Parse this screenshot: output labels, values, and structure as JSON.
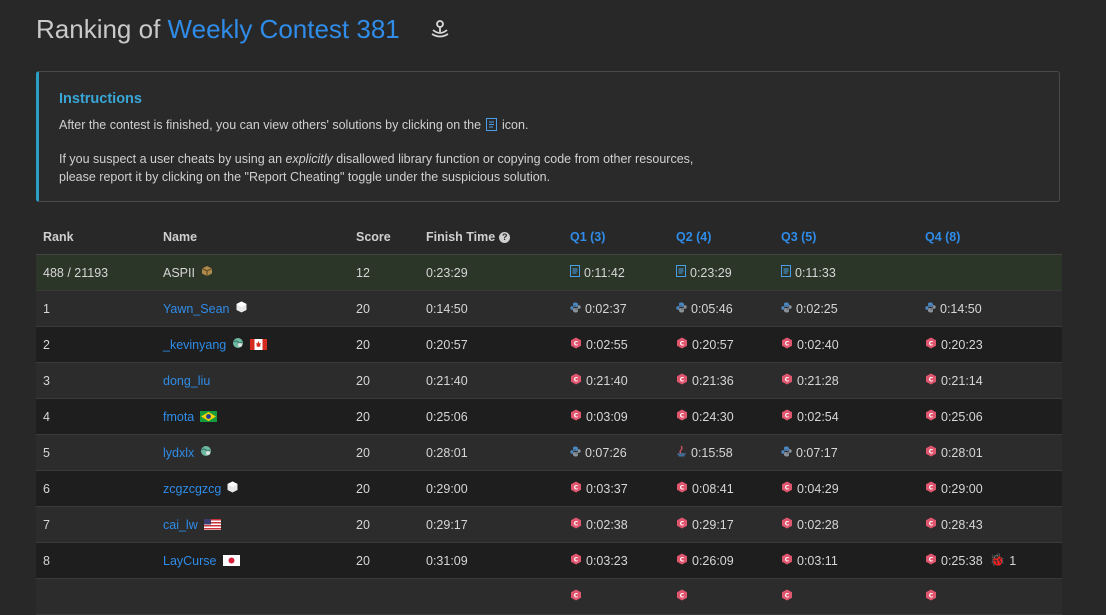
{
  "page": {
    "title_prefix": "Ranking of",
    "contest_name": "Weekly Contest 381"
  },
  "instructions": {
    "heading": "Instructions",
    "line1_before": "After the contest is finished, you can view others' solutions by clicking on the",
    "line1_after": "icon.",
    "line2_before": "If you suspect a user cheats by using an",
    "line2_emph": "explicitly",
    "line2_after": "disallowed library function or copying code from other resources,",
    "line3": "please report it by clicking on the \"Report Cheating\" toggle under the suspicious solution."
  },
  "table": {
    "headers": {
      "rank": "Rank",
      "name": "Name",
      "score": "Score",
      "finish_time": "Finish Time",
      "q1": "Q1 (3)",
      "q2": "Q2 (4)",
      "q3": "Q3 (5)",
      "q4": "Q4 (8)"
    },
    "my_row": {
      "rank": "488 / 21193",
      "name": "ASPII",
      "score": "12",
      "finish_time": "0:23:29",
      "q1": "0:11:42",
      "q2": "0:23:29",
      "q3": "0:11:33",
      "q4": ""
    },
    "rows": [
      {
        "rank": "1",
        "name": "Yawn_Sean",
        "badge": "white-hex-badge",
        "flag": "",
        "score": "20",
        "finish_time": "0:14:50",
        "q": [
          {
            "lang": "python",
            "time": "0:02:37"
          },
          {
            "lang": "python",
            "time": "0:05:46"
          },
          {
            "lang": "python",
            "time": "0:02:25"
          },
          {
            "lang": "python",
            "time": "0:14:50"
          }
        ]
      },
      {
        "rank": "2",
        "name": "_kevinyang",
        "badge": "globe-badge",
        "flag": "canada",
        "score": "20",
        "finish_time": "0:20:57",
        "q": [
          {
            "lang": "cpp",
            "time": "0:02:55"
          },
          {
            "lang": "cpp",
            "time": "0:20:57"
          },
          {
            "lang": "cpp",
            "time": "0:02:40"
          },
          {
            "lang": "cpp",
            "time": "0:20:23"
          }
        ]
      },
      {
        "rank": "3",
        "name": "dong_liu",
        "badge": "",
        "flag": "",
        "score": "20",
        "finish_time": "0:21:40",
        "q": [
          {
            "lang": "cpp",
            "time": "0:21:40"
          },
          {
            "lang": "cpp",
            "time": "0:21:36"
          },
          {
            "lang": "cpp",
            "time": "0:21:28"
          },
          {
            "lang": "cpp",
            "time": "0:21:14"
          }
        ]
      },
      {
        "rank": "4",
        "name": "fmota",
        "badge": "",
        "flag": "brazil",
        "score": "20",
        "finish_time": "0:25:06",
        "q": [
          {
            "lang": "cpp",
            "time": "0:03:09"
          },
          {
            "lang": "cpp",
            "time": "0:24:30"
          },
          {
            "lang": "cpp",
            "time": "0:02:54"
          },
          {
            "lang": "cpp",
            "time": "0:25:06"
          }
        ]
      },
      {
        "rank": "5",
        "name": "lydxlx",
        "badge": "globe-badge",
        "flag": "",
        "score": "20",
        "finish_time": "0:28:01",
        "q": [
          {
            "lang": "python",
            "time": "0:07:26"
          },
          {
            "lang": "java",
            "time": "0:15:58"
          },
          {
            "lang": "python",
            "time": "0:07:17"
          },
          {
            "lang": "cpp",
            "time": "0:28:01"
          }
        ]
      },
      {
        "rank": "6",
        "name": "zcgzcgzcg",
        "badge": "white-hex-badge",
        "flag": "",
        "score": "20",
        "finish_time": "0:29:00",
        "q": [
          {
            "lang": "cpp",
            "time": "0:03:37"
          },
          {
            "lang": "cpp",
            "time": "0:08:41"
          },
          {
            "lang": "cpp",
            "time": "0:04:29"
          },
          {
            "lang": "cpp",
            "time": "0:29:00"
          }
        ]
      },
      {
        "rank": "7",
        "name": "cai_lw",
        "badge": "",
        "flag": "usa",
        "score": "20",
        "finish_time": "0:29:17",
        "q": [
          {
            "lang": "cpp",
            "time": "0:02:38"
          },
          {
            "lang": "cpp",
            "time": "0:29:17"
          },
          {
            "lang": "cpp",
            "time": "0:02:28"
          },
          {
            "lang": "cpp",
            "time": "0:28:43"
          }
        ]
      },
      {
        "rank": "8",
        "name": "LayCurse",
        "badge": "",
        "flag": "japan",
        "score": "20",
        "finish_time": "0:31:09",
        "q": [
          {
            "lang": "cpp",
            "time": "0:03:23"
          },
          {
            "lang": "cpp",
            "time": "0:26:09"
          },
          {
            "lang": "cpp",
            "time": "0:03:11"
          },
          {
            "lang": "cpp",
            "time": "0:25:38",
            "bugs": "1"
          }
        ]
      },
      {
        "rank": "",
        "name": "",
        "badge": "",
        "flag": "",
        "score": "",
        "finish_time": "",
        "q": [
          {
            "lang": "cpp",
            "time": ""
          },
          {
            "lang": "cpp",
            "time": ""
          },
          {
            "lang": "cpp",
            "time": ""
          },
          {
            "lang": "cpp",
            "time": ""
          }
        ]
      }
    ]
  },
  "colors": {
    "accent": "#2f8ce8",
    "instructions_heading": "#39a6d7",
    "my_row_bg": "#2b3528",
    "cpp_icon": "#e0566e",
    "python_icon": "#4b86c0"
  }
}
